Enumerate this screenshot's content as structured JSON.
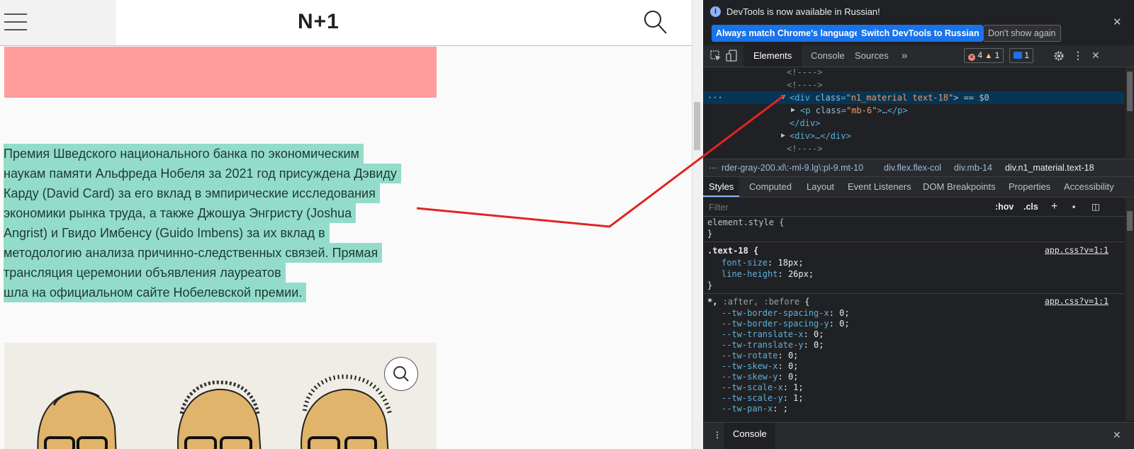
{
  "page": {
    "logo": "N+1",
    "article_lines": [
      "Премия Шведского национального банка по экономическим",
      "наукам памяти Альфреда Нобеля за 2021 год присуждена Дэвиду",
      "Карду (David Card) за его вклад в эмпирические исследования",
      "экономики рынка труда, а также Джошуа Энгристу (Joshua",
      "Angrist) и Гвидо Имбенсу (Guido Imbens) за их вклад в",
      "методологию анализа причинно-следственных связей. Прямая",
      "трансляция церемонии объявления лауреатов",
      "шла на официальном сайте Нобелевской премии."
    ]
  },
  "devtools": {
    "infobar": {
      "message": "DevTools is now available in Russian!",
      "btn_match": "Always match Chrome's language",
      "btn_switch": "Switch DevTools to Russian",
      "btn_dismiss": "Don't show again"
    },
    "tabs": [
      "Elements",
      "Console",
      "Sources"
    ],
    "more_tabs": "»",
    "errors": "4",
    "warnings": "1",
    "messages": "1",
    "dom": {
      "c1": "<!---->",
      "c2": "<!---->",
      "sel_tag_open": "<div ",
      "sel_attr": "class",
      "sel_val": "\"n1_material text-18\"",
      "sel_suffix": "> == $0",
      "child_open": "<p ",
      "child_attr": "class",
      "child_val": "\"mb-6\"",
      "child_rest": ">…</p>",
      "close_div": "</div>",
      "div_collapsed": "<div>…</div>",
      "c3": "<!---->"
    },
    "breadcrumbs": [
      "rder-gray-200.xl\\:-ml-9.lg\\:pl-9.mt-10",
      "div.flex.flex-col",
      "div.mb-14",
      "div.n1_material.text-18"
    ],
    "subtabs": [
      "Styles",
      "Computed",
      "Layout",
      "Event Listeners",
      "DOM Breakpoints",
      "Properties",
      "Accessibility"
    ],
    "filter_placeholder": "Filter",
    "hov": ":hov",
    "cls": ".cls",
    "styles": {
      "element_style": "element.style {",
      "close": "}",
      "rule1_selector": ".text-18 {",
      "rule1_source": "app.css?v=1:1",
      "rule1_props": [
        {
          "name": "font-size",
          "value": "18px;"
        },
        {
          "name": "line-height",
          "value": "26px;"
        }
      ],
      "rule2_selector_a": "*, ",
      "rule2_selector_b": ":after, :before",
      "rule2_selector_c": " {",
      "rule2_source": "app.css?v=1:1",
      "rule2_props": [
        {
          "name": "--tw-border-spacing-x",
          "value": "0;"
        },
        {
          "name": "--tw-border-spacing-y",
          "value": "0;"
        },
        {
          "name": "--tw-translate-x",
          "value": "0;"
        },
        {
          "name": "--tw-translate-y",
          "value": "0;"
        },
        {
          "name": "--tw-rotate",
          "value": "0;"
        },
        {
          "name": "--tw-skew-x",
          "value": "0;"
        },
        {
          "name": "--tw-skew-y",
          "value": "0;"
        },
        {
          "name": "--tw-scale-x",
          "value": "1;"
        },
        {
          "name": "--tw-scale-y",
          "value": "1;"
        },
        {
          "name": "--tw-pan-x",
          "value": ";"
        }
      ]
    },
    "drawer_tab": "Console"
  },
  "colors": {
    "highlight": "#93dccb",
    "red_block": "#ff9c9c",
    "annotation": "#e02424",
    "devtools_bg": "#202124"
  }
}
